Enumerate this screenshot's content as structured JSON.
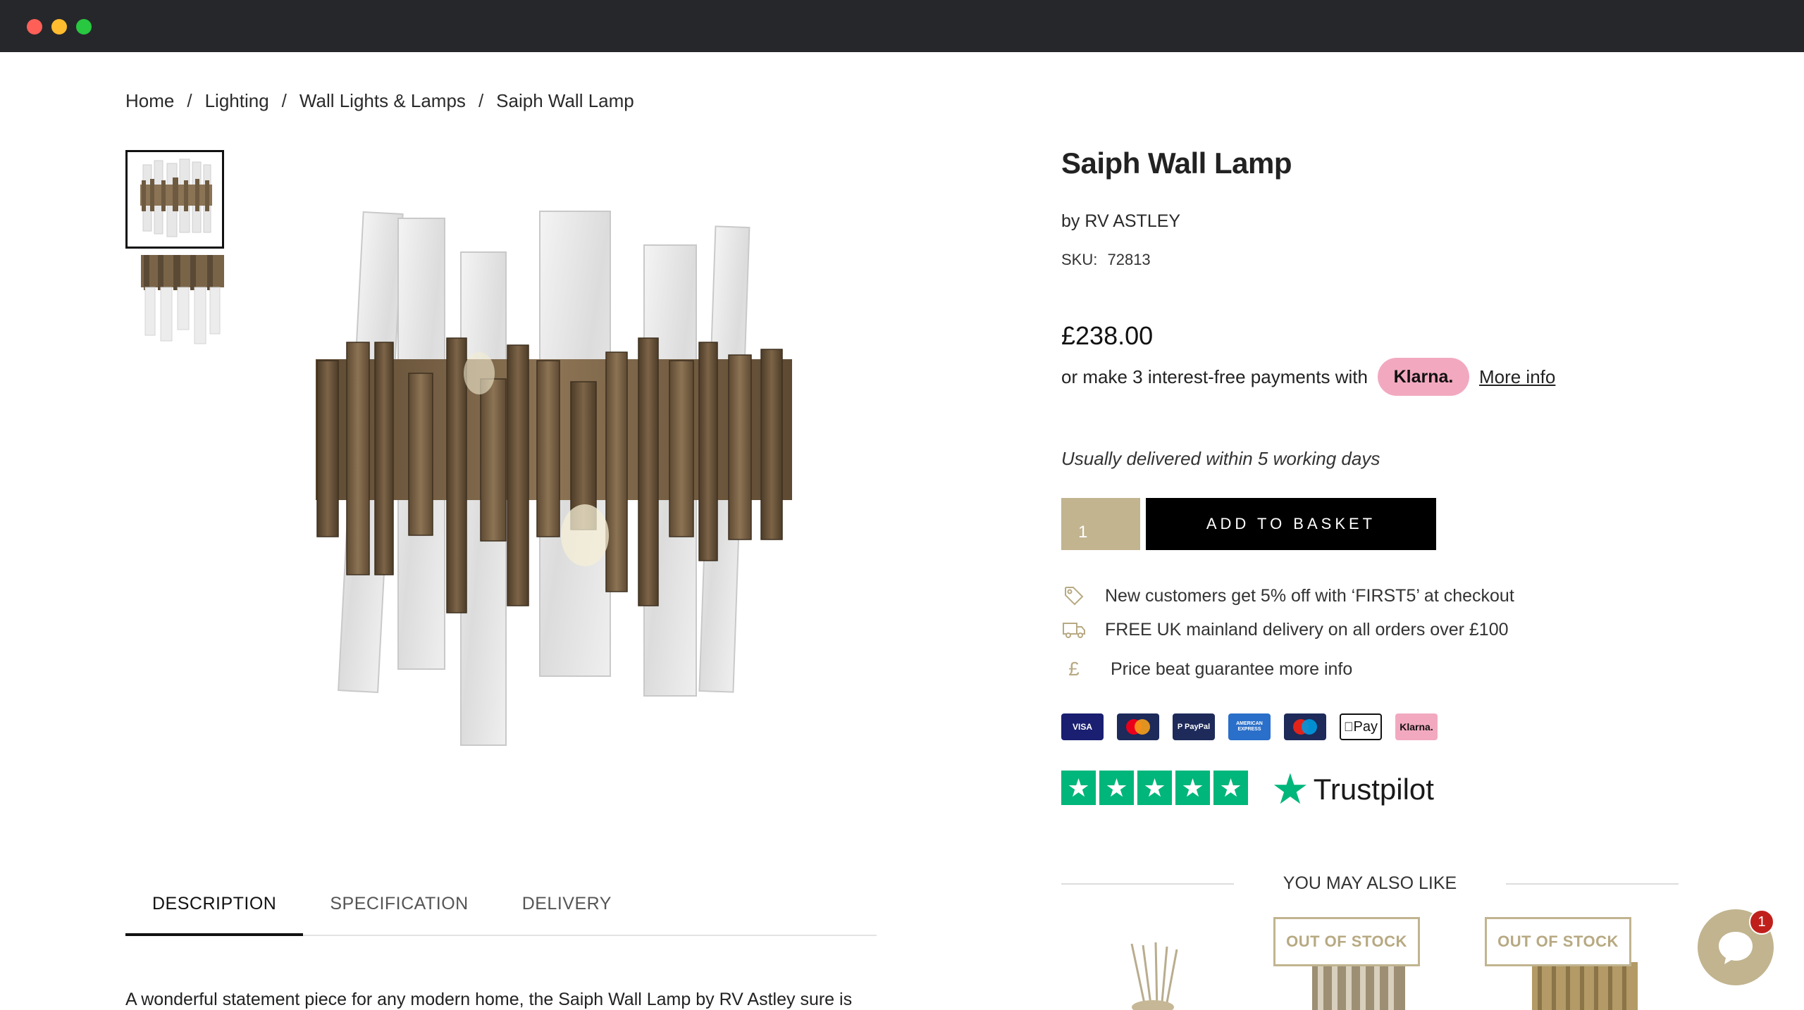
{
  "breadcrumb": {
    "items": [
      "Home",
      "Lighting",
      "Wall Lights & Lamps",
      "Saiph Wall Lamp"
    ],
    "separator": "/"
  },
  "product": {
    "title": "Saiph Wall Lamp",
    "brand": "by RV ASTLEY",
    "sku_label": "SKU:",
    "sku": "72813",
    "price": "£238.00",
    "klarna_text": "or make 3 interest-free payments with",
    "klarna_badge": "Klarna.",
    "more_info": "More info",
    "delivery_note": "Usually delivered within 5 working days",
    "quantity": "1",
    "add_to_basket": "ADD TO BASKET"
  },
  "perks": [
    {
      "icon": "tag-icon",
      "text": "New customers get 5% off with ‘FIRST5’ at checkout"
    },
    {
      "icon": "truck-icon",
      "text": "FREE UK mainland delivery on all orders over £100"
    },
    {
      "icon": "pound-icon",
      "text": "Price beat guarantee more info"
    }
  ],
  "payment_methods": [
    {
      "name": "visa-icon",
      "label": "VISA",
      "color": "#1a1f71"
    },
    {
      "name": "mastercard-icon",
      "label": "",
      "color": "#1d2a5a"
    },
    {
      "name": "paypal-icon",
      "label": "P PayPal",
      "color": "#1d2a5a"
    },
    {
      "name": "amex-icon",
      "label": "AMERICAN EXPRESS",
      "color": "#2a6fc9"
    },
    {
      "name": "maestro-icon",
      "label": "",
      "color": "#1d2a5a"
    },
    {
      "name": "applepay-icon",
      "label": "Pay",
      "color": "#ffffff"
    },
    {
      "name": "klarna-icon",
      "label": "Klarna.",
      "color": "#f2a9c0"
    }
  ],
  "trustpilot": {
    "label": "Trustpilot",
    "stars": 5
  },
  "tabs": [
    "DESCRIPTION",
    "SPECIFICATION",
    "DELIVERY"
  ],
  "description": "A wonderful statement piece for any modern home, the Saiph Wall Lamp by RV Astley sure is",
  "also_like": {
    "title": "YOU MAY ALSO LIKE",
    "badge": "OUT OF STOCK"
  },
  "chat": {
    "unread": "1"
  },
  "colors": {
    "accent": "#c1b48f",
    "klarna": "#f2a9c0",
    "trustpilot": "#00b67a"
  }
}
